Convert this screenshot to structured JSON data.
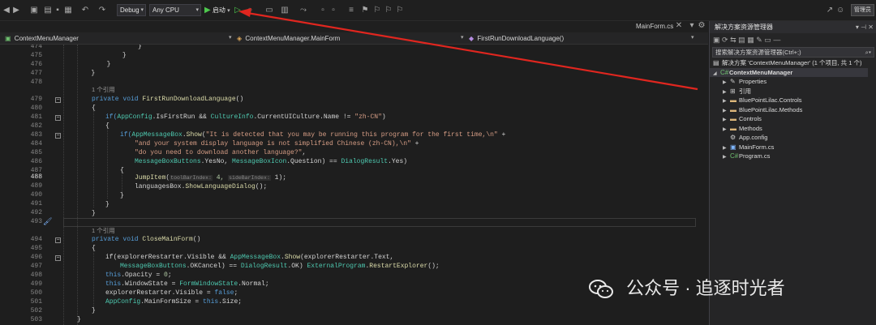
{
  "toolbar": {
    "config": "Debug",
    "platform": "Any CPU",
    "start_label": "启动",
    "admin_label": "管理员"
  },
  "doc_tab": "MainForm.cs",
  "nav": {
    "project": "ContextMenuManager",
    "class": "ContextMenuManager.MainForm",
    "member": "FirstRunDownloadLanguage()"
  },
  "editor": {
    "line_numbers": [
      "474",
      "475",
      "476",
      "477",
      "478",
      "",
      "479",
      "480",
      "481",
      "482",
      "483",
      "484",
      "485",
      "486",
      "487",
      "488",
      "489",
      "490",
      "491",
      "492",
      "493",
      "",
      "494",
      "495",
      "496",
      "497",
      "498",
      "499",
      "500",
      "501",
      "502",
      "503"
    ],
    "current_line": "488",
    "codelens": "1 个引用",
    "lines": {
      "l474": "                    }",
      "l475": "                }",
      "l476": "            }",
      "l477": "        }",
      "l478": "",
      "cl1": "1 个引用",
      "l479a": "private void ",
      "l479b": "FirstRunDownloadLanguage",
      "l479c": "()",
      "l480": "{",
      "l481a": "if(",
      "l481b": "AppConfig",
      "l481c": ".IsFirstRun && ",
      "l481d": "CultureInfo",
      "l481e": ".CurrentUICulture.Name != ",
      "l481f": "\"zh-CN\"",
      "l481g": ")",
      "l482": "{",
      "l483a": "if(",
      "l483b": "AppMessageBox",
      "l483c": ".",
      "l483d": "Show",
      "l483e": "(",
      "l483f": "\"It is detected that you may be running this program for the first time,\\n\"",
      "l483g": " +",
      "l484a": "\"and your system display language is not simplified Chinese (zh-CN),\\n\"",
      "l484b": " +",
      "l485a": "\"do you need to download another language?\"",
      "l485b": ",",
      "l486a": "MessageBoxButtons",
      "l486b": ".YesNo, ",
      "l486c": "MessageBoxIcon",
      "l486d": ".Question) == ",
      "l486e": "DialogResult",
      "l486f": ".Yes)",
      "l487": "{",
      "l488a": "JumpItem",
      "l488b": "(",
      "l488h1": "toolBarIndex:",
      "l488c": " 4, ",
      "l488h2": "sideBarIndex:",
      "l488d": " 1);",
      "l489a": "languagesBox.",
      "l489b": "ShowLanguageDialog",
      "l489c": "();",
      "l490": "}",
      "l491": "}",
      "l492": "}",
      "l493": "",
      "cl2": "1 个引用",
      "l494a": "private void ",
      "l494b": "CloseMainForm",
      "l494c": "()",
      "l495": "{",
      "l496a": "if(explorerRestarter.Visible && ",
      "l496b": "AppMessageBox",
      "l496c": ".",
      "l496d": "Show",
      "l496e": "(explorerRestarter.Text,",
      "l497a": "MessageBoxButtons",
      "l497b": ".OKCancel) == ",
      "l497c": "DialogResult",
      "l497d": ".OK) ",
      "l497e": "ExternalProgram",
      "l497f": ".",
      "l497g": "RestartExplorer",
      "l497h": "();",
      "l498a": "this",
      "l498b": ".Opacity = ",
      "l498c": "0",
      "l498d": ";",
      "l499a": "this",
      "l499b": ".WindowState = ",
      "l499c": "FormWindowState",
      "l499d": ".Normal;",
      "l500a": "explorerRestarter.Visible = ",
      "l500b": "false",
      "l500c": ";",
      "l501a": "AppConfig",
      "l501b": ".MainFormSize = ",
      "l501c": "this",
      "l501d": ".Size;",
      "l502": "}",
      "l503": "}"
    }
  },
  "solution": {
    "title": "解决方案资源管理器",
    "search_placeholder": "搜索解决方案资源管理器(Ctrl+;)",
    "items": [
      {
        "label": "解决方案 'ContextMenuManager' (1 个项目, 共 1 个)",
        "icon": "solution-icon"
      },
      {
        "label": "ContextMenuManager",
        "icon": "csharp-project-icon"
      },
      {
        "label": "Properties",
        "icon": "wrench-icon"
      },
      {
        "label": "引用",
        "icon": "references-icon"
      },
      {
        "label": "BluePointLilac.Controls",
        "icon": "folder-icon"
      },
      {
        "label": "BluePointLilac.Methods",
        "icon": "folder-icon"
      },
      {
        "label": "Controls",
        "icon": "folder-icon"
      },
      {
        "label": "Methods",
        "icon": "folder-icon"
      },
      {
        "label": "App.config",
        "icon": "config-file-icon"
      },
      {
        "label": "MainForm.cs",
        "icon": "form-file-icon"
      },
      {
        "label": "Program.cs",
        "icon": "csharp-file-icon"
      }
    ]
  },
  "watermark": "公众号 · 追逐时光者",
  "colors": {
    "annotation_arrow": "#e0261f",
    "run_green": "#4ec94e",
    "editor_bg": "#1e1e1e",
    "keyword": "#569cd6",
    "type": "#4ec9b0",
    "method": "#dcdcaa",
    "string": "#d69d85"
  }
}
